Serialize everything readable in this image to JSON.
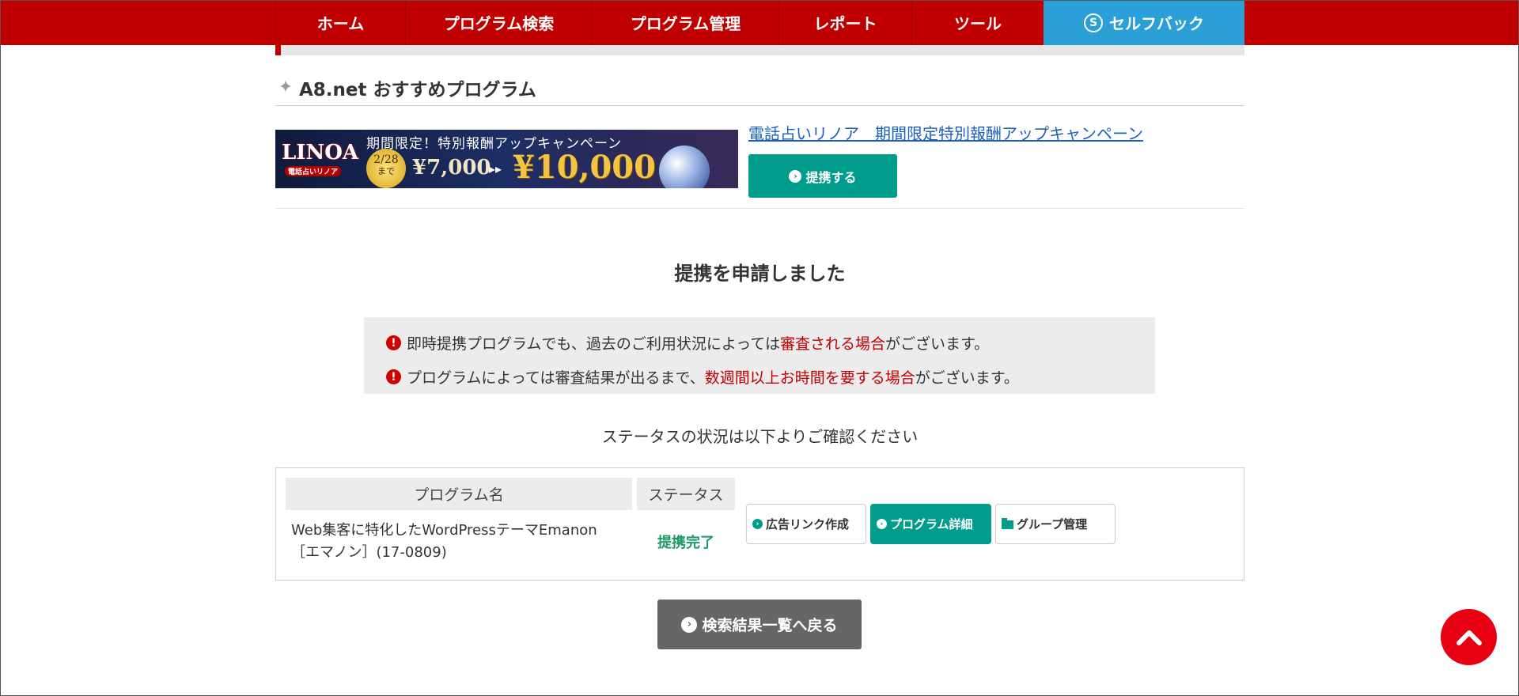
{
  "nav": {
    "items": [
      {
        "label": "ホーム"
      },
      {
        "label": "プログラム検索"
      },
      {
        "label": "プログラム管理"
      },
      {
        "label": "レポート"
      },
      {
        "label": "ツール"
      },
      {
        "label": "セルフバック",
        "icon": "selfback-s-icon"
      }
    ],
    "selected": "セルフバック",
    "colors": {
      "bar": "#c00000",
      "selected": "#2b9fd6"
    }
  },
  "recommend": {
    "title": "A8.net おすすめプログラム",
    "banner": {
      "logo": "LINOA",
      "logo_sub": "電話占いリノア",
      "headline": "期間限定！特別報酬アップキャンペーン",
      "date": "2/28",
      "date_suffix": "まで",
      "price_old": "¥7,000",
      "price_new": "¥10,000"
    },
    "campaign_link": "電話占いリノア　期間限定特別報酬アップキャンペーン",
    "partner_button": "提携する"
  },
  "result": {
    "title": "提携を申請しました",
    "notices": [
      {
        "before": "即時提携プログラムでも、過去のご利用状況によっては",
        "highlight": "審査される場合",
        "after": "がございます。"
      },
      {
        "before": "プログラムによっては審査結果が出るまで、",
        "highlight": "数週間以上お時間を要する場合",
        "after": "がございます。"
      }
    ],
    "status_caption": "ステータスの状況は以下よりご確認ください"
  },
  "table": {
    "headers": {
      "name": "プログラム名",
      "status": "ステータス"
    },
    "row": {
      "name_line1": "Web集客に特化したWordPressテーマEmanon",
      "name_line2": "［エマノン］(17-0809)",
      "status": "提携完了"
    },
    "actions": {
      "ad_link": "広告リンク作成",
      "detail": "プログラム詳細",
      "group": "グループ管理"
    }
  },
  "back_button": "検索結果一覧へ戻る"
}
